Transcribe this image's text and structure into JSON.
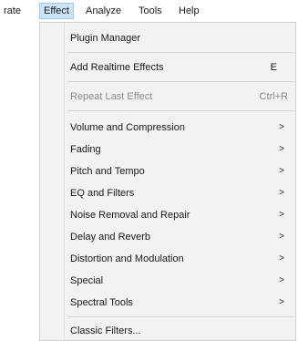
{
  "menubar": {
    "items": [
      "rate",
      "Effect",
      "Analyze",
      "Tools",
      "Help"
    ]
  },
  "menu": {
    "plugin_manager": "Plugin Manager",
    "add_realtime": {
      "label": "Add Realtime Effects",
      "shortcut": "E"
    },
    "repeat_last": {
      "label": "Repeat Last Effect",
      "shortcut": "Ctrl+R"
    },
    "submenus": [
      "Volume and Compression",
      "Fading",
      "Pitch and Tempo",
      "EQ and Filters",
      "Noise Removal and Repair",
      "Delay and Reverb",
      "Distortion and Modulation",
      "Special",
      "Spectral Tools"
    ],
    "classic_filters": "Classic Filters..."
  },
  "icons": {
    "submenu_arrow": ">"
  },
  "colors": {
    "active_menu_bg": "#cce4f7",
    "active_menu_border": "#99c9ef",
    "menu_bg": "#f2f2f2",
    "disabled_text": "#8a8a8a"
  }
}
